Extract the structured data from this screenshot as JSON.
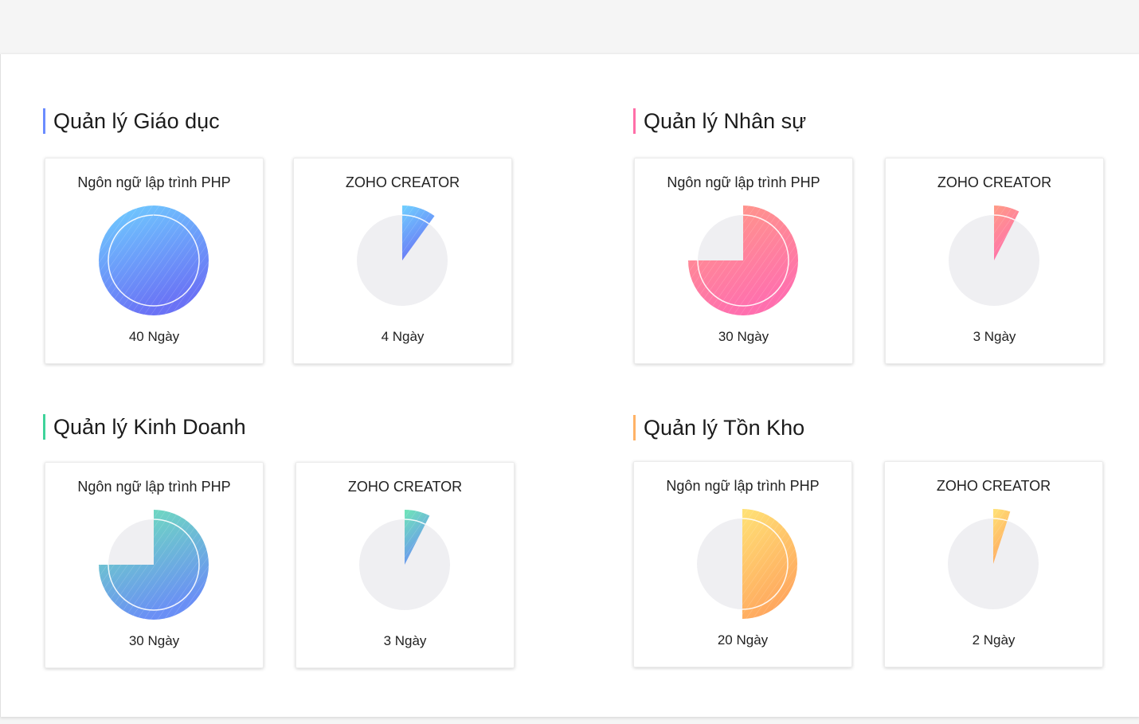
{
  "max_days": 40,
  "sections": [
    {
      "title": "Quản lý Giáo dục",
      "accent": "#6b8cff",
      "gradient": [
        "#6fd0ff",
        "#6a72f5"
      ],
      "cards": [
        {
          "title": "Ngôn ngữ lập trình PHP",
          "days": 40,
          "value_label": "40 Ngày"
        },
        {
          "title": "ZOHO CREATOR",
          "days": 4,
          "value_label": "4 Ngày"
        }
      ]
    },
    {
      "title": "Quản lý Nhân sự",
      "accent": "#ff6fa8",
      "gradient": [
        "#ff9b85",
        "#ff6fae"
      ],
      "cards": [
        {
          "title": "Ngôn ngữ lập trình PHP",
          "days": 30,
          "value_label": "30 Ngày"
        },
        {
          "title": "ZOHO CREATOR",
          "days": 3,
          "value_label": "3 Ngày"
        }
      ]
    },
    {
      "title": "Quản lý Kinh Doanh",
      "accent": "#3fd39a",
      "gradient": [
        "#6fe6b7",
        "#6a8ff5"
      ],
      "cards": [
        {
          "title": "Ngôn ngữ lập trình PHP",
          "days": 30,
          "value_label": "30 Ngày"
        },
        {
          "title": "ZOHO CREATOR",
          "days": 3,
          "value_label": "3 Ngày"
        }
      ]
    },
    {
      "title": "Quản lý Tồn Kho",
      "accent": "#ffb266",
      "gradient": [
        "#ffe276",
        "#ffa65e"
      ],
      "cards": [
        {
          "title": "Ngôn ngữ lập trình PHP",
          "days": 20,
          "value_label": "20 Ngày"
        },
        {
          "title": "ZOHO CREATOR",
          "days": 2,
          "value_label": "2 Ngày"
        }
      ]
    }
  ]
}
